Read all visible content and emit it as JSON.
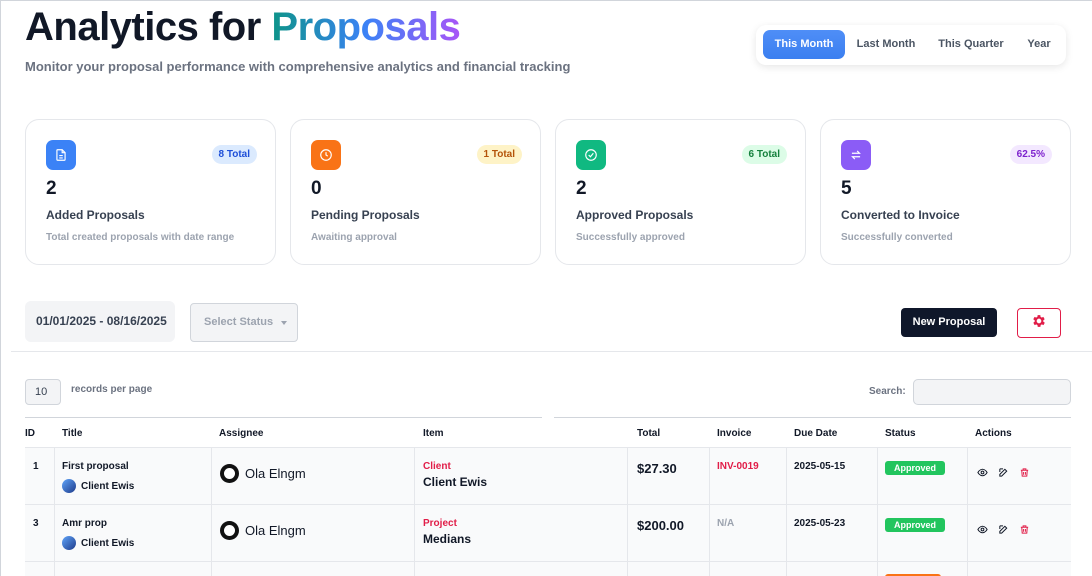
{
  "header": {
    "title_prefix": "Analytics for",
    "title_accent": "Proposals",
    "subtitle": "Monitor your proposal performance with comprehensive analytics and financial tracking"
  },
  "period_tabs": [
    {
      "label": "This Month",
      "active": true
    },
    {
      "label": "Last Month",
      "active": false
    },
    {
      "label": "This Quarter",
      "active": false
    },
    {
      "label": "Year",
      "active": false
    }
  ],
  "cards": [
    {
      "icon": "document-icon",
      "color": "#3b82f6",
      "badge": "8 Total",
      "badge_bg": "#dbeafe",
      "badge_fg": "#1d4ed8",
      "value": "2",
      "label": "Added Proposals",
      "sub": "Total created proposals with date range"
    },
    {
      "icon": "clock-icon",
      "color": "#f97316",
      "badge": "1 Total",
      "badge_bg": "#fef3c7",
      "badge_fg": "#b45309",
      "value": "0",
      "label": "Pending Proposals",
      "sub": "Awaiting approval"
    },
    {
      "icon": "check-circle-icon",
      "color": "#10b981",
      "badge": "6 Total",
      "badge_bg": "#dcfce7",
      "badge_fg": "#15803d",
      "value": "2",
      "label": "Approved Proposals",
      "sub": "Successfully approved"
    },
    {
      "icon": "exchange-icon",
      "color": "#8b5cf6",
      "badge": "62.5%",
      "badge_bg": "#f3e8ff",
      "badge_fg": "#7e22ce",
      "value": "5",
      "label": "Converted to Invoice",
      "sub": "Successfully converted"
    }
  ],
  "filters": {
    "date_range": "01/01/2025 - 08/16/2025",
    "status_placeholder": "Select Status"
  },
  "toolbar": {
    "new_label": "New Proposal"
  },
  "table_controls": {
    "records_value": "10",
    "records_label": "records per page",
    "search_label": "Search:"
  },
  "table": {
    "columns": [
      "ID",
      "Title",
      "Assignee",
      "Item",
      "Total",
      "Invoice",
      "Due Date",
      "Status",
      "Actions"
    ],
    "rows": [
      {
        "id": "1",
        "title": "First proposal",
        "client": "Client Ewis",
        "assignee": "Ola Elngm",
        "item_type": "Client",
        "item_name": "Client Ewis",
        "total": "$27.30",
        "invoice": "INV-0019",
        "due": "2025-05-15",
        "status": "Approved"
      },
      {
        "id": "3",
        "title": "Amr prop",
        "client": "Client Ewis",
        "assignee": "Ola Elngm",
        "item_type": "Project",
        "item_name": "Medians",
        "total": "$200.00",
        "invoice": "N/A",
        "due": "2025-05-23",
        "status": "Approved"
      }
    ]
  }
}
